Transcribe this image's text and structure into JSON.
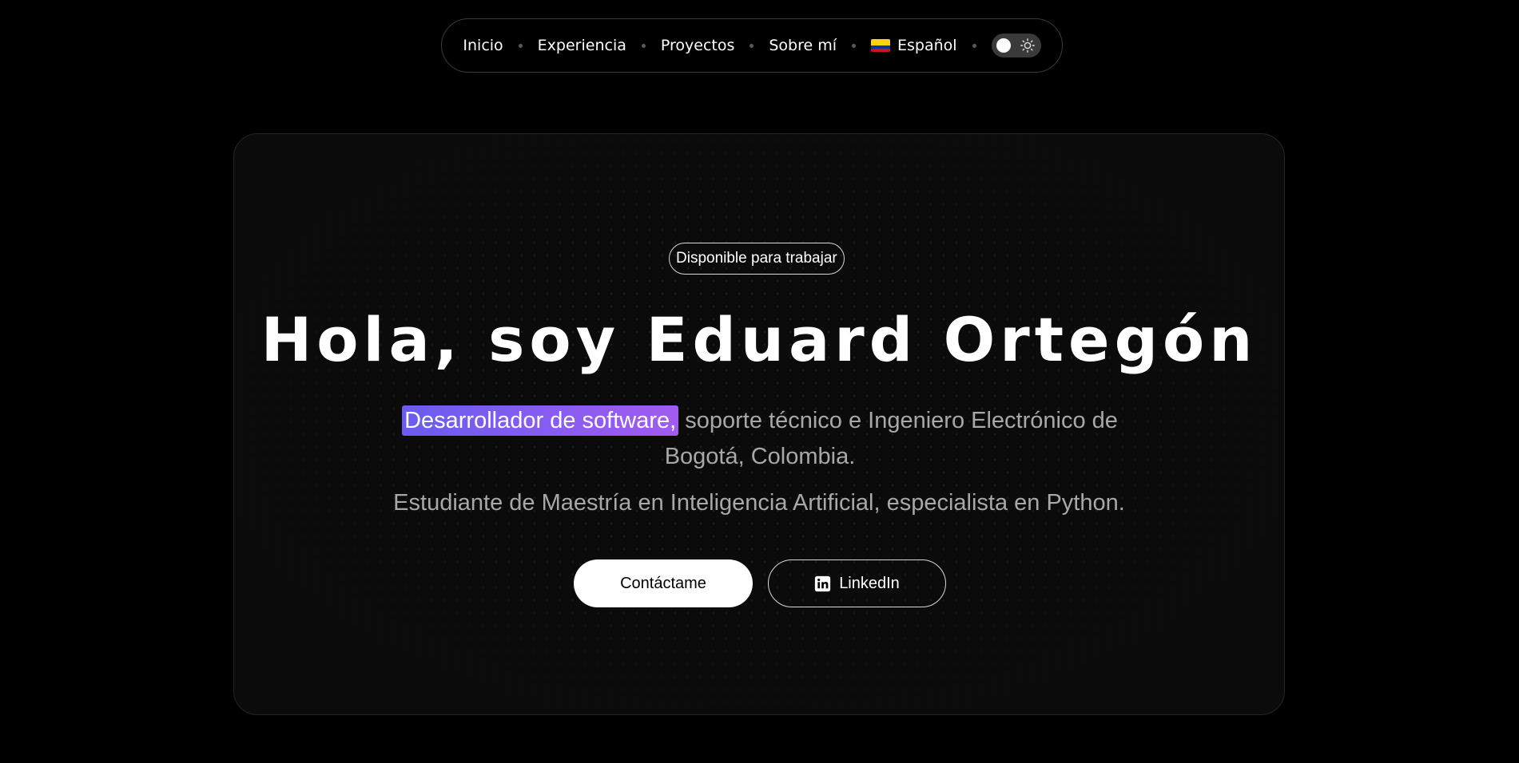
{
  "nav": {
    "items": [
      {
        "label": "Inicio"
      },
      {
        "label": "Experiencia"
      },
      {
        "label": "Proyectos"
      },
      {
        "label": "Sobre mí"
      }
    ],
    "language": {
      "label": "Español",
      "flag_icon": "colombia-flag-icon"
    },
    "theme_toggle": {
      "icon": "sun-icon",
      "state": "dark"
    }
  },
  "hero": {
    "badge": "Disponible para trabajar",
    "title": "Hola, soy Eduard Ortegón",
    "lead_highlight": "Desarrollador de software,",
    "lead_rest": " soporte técnico e Ingeniero Electrónico de Bogotá, Colombia.",
    "subtitle": "Estudiante de Maestría en Inteligencia Artificial, especialista en Python.",
    "buttons": {
      "contact": "Contáctame",
      "linkedin": "LinkedIn",
      "linkedin_icon": "linkedin-icon"
    }
  },
  "colors": {
    "background": "#000000",
    "card": "#0b0b0b",
    "highlight_start": "#6a5cf0",
    "highlight_end": "#a25bf0",
    "text_muted": "#a8a8a8"
  }
}
